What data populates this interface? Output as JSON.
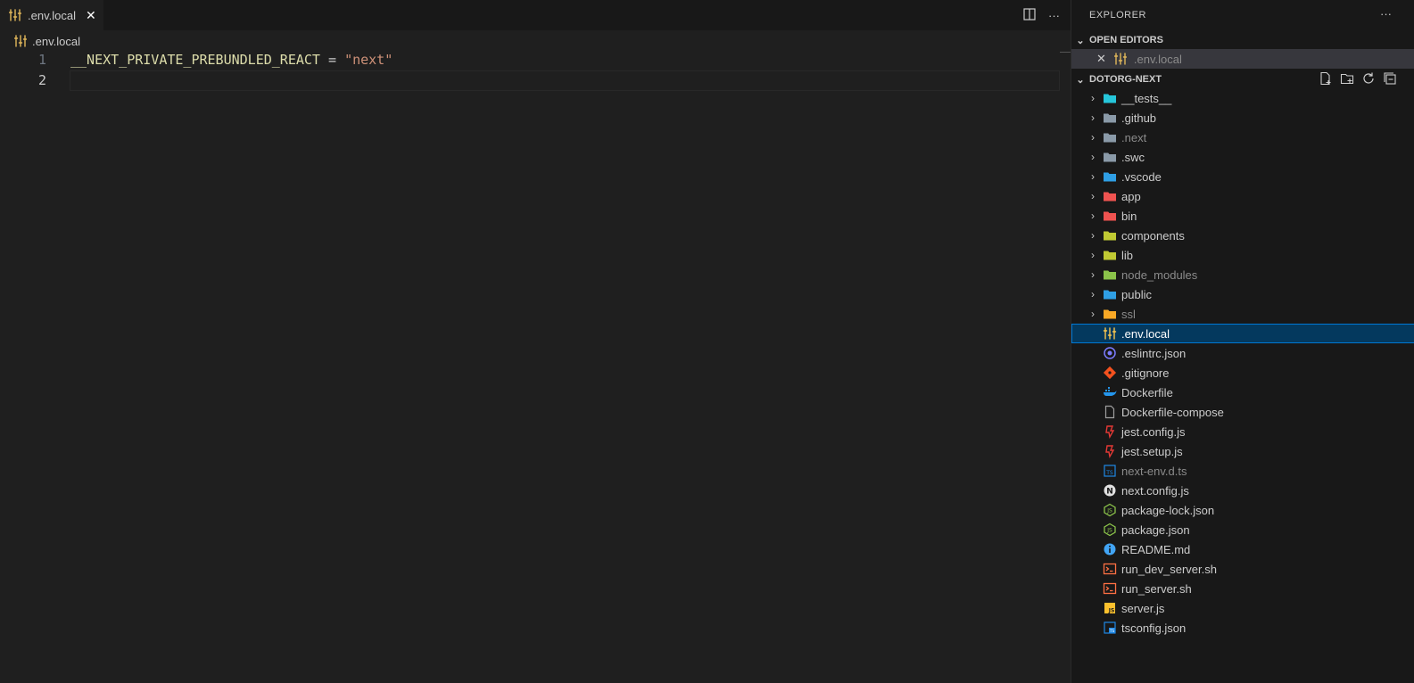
{
  "tab": {
    "label": ".env.local",
    "close_glyph": "✕"
  },
  "tab_actions": {
    "split_icon": "split-editor-icon",
    "more_glyph": "···"
  },
  "breadcrumb": {
    "label": ".env.local"
  },
  "code": {
    "lines": [
      {
        "number": "1",
        "key": "__NEXT_PRIVATE_PREBUNDLED_REACT",
        "op": " = ",
        "value": "\"next\""
      },
      {
        "number": "2"
      }
    ]
  },
  "explorer": {
    "title": "EXPLORER",
    "more_glyph": "···",
    "open_editors": {
      "title": "OPEN EDITORS",
      "close_glyph": "✕",
      "items": [
        {
          "label": ".env.local"
        }
      ]
    },
    "project": {
      "title": "DOTORG-NEXT",
      "actions": [
        "new-file-icon",
        "new-folder-icon",
        "refresh-icon",
        "collapse-all-icon"
      ]
    },
    "folders": [
      {
        "label": "__tests__",
        "icon": "folder-tests-icon",
        "color": "#26c6da"
      },
      {
        "label": ".github",
        "icon": "folder-github-icon",
        "color": "#8a9aa8"
      },
      {
        "label": ".next",
        "icon": "folder-next-icon",
        "color": "#8a9aa8",
        "dim": true
      },
      {
        "label": ".swc",
        "icon": "folder-icon",
        "color": "#8a9aa8"
      },
      {
        "label": ".vscode",
        "icon": "folder-vscode-icon",
        "color": "#2f9fe5"
      },
      {
        "label": "app",
        "icon": "folder-app-icon",
        "color": "#ef5350"
      },
      {
        "label": "bin",
        "icon": "folder-bin-icon",
        "color": "#ef5350"
      },
      {
        "label": "components",
        "icon": "folder-components-icon",
        "color": "#c0ca33"
      },
      {
        "label": "lib",
        "icon": "folder-lib-icon",
        "color": "#c0ca33"
      },
      {
        "label": "node_modules",
        "icon": "folder-node-icon",
        "color": "#8bc34a",
        "dim": true
      },
      {
        "label": "public",
        "icon": "folder-public-icon",
        "color": "#2f9fe5"
      },
      {
        "label": "ssl",
        "icon": "folder-ssl-icon",
        "color": "#f9a825",
        "dim": true
      }
    ],
    "files": [
      {
        "label": ".env.local",
        "icon": "env-file-icon",
        "color": "#f9c74f",
        "selected": true
      },
      {
        "label": ".eslintrc.json",
        "icon": "eslint-icon",
        "color": "#7c7cff"
      },
      {
        "label": ".gitignore",
        "icon": "git-icon",
        "color": "#f4511e"
      },
      {
        "label": "Dockerfile",
        "icon": "docker-icon",
        "color": "#2496ed"
      },
      {
        "label": "Dockerfile-compose",
        "icon": "file-icon",
        "color": "#9e9e9e"
      },
      {
        "label": "jest.config.js",
        "icon": "jest-icon",
        "color": "#e53935"
      },
      {
        "label": "jest.setup.js",
        "icon": "jest-icon",
        "color": "#e53935"
      },
      {
        "label": "next-env.d.ts",
        "icon": "typescript-def-icon",
        "color": "#1e88e5",
        "dim": true
      },
      {
        "label": "next.config.js",
        "icon": "nextjs-icon",
        "color": "#e0e0e0"
      },
      {
        "label": "package-lock.json",
        "icon": "npm-icon",
        "color": "#8bc34a"
      },
      {
        "label": "package.json",
        "icon": "npm-icon",
        "color": "#8bc34a"
      },
      {
        "label": "README.md",
        "icon": "info-icon",
        "color": "#42a5f5"
      },
      {
        "label": "run_dev_server.sh",
        "icon": "shell-icon",
        "color": "#ff7043"
      },
      {
        "label": "run_server.sh",
        "icon": "shell-icon",
        "color": "#ff7043"
      },
      {
        "label": "server.js",
        "icon": "javascript-icon",
        "color": "#fbc02d"
      },
      {
        "label": "tsconfig.json",
        "icon": "tsconfig-icon",
        "color": "#1e88e5"
      }
    ]
  }
}
